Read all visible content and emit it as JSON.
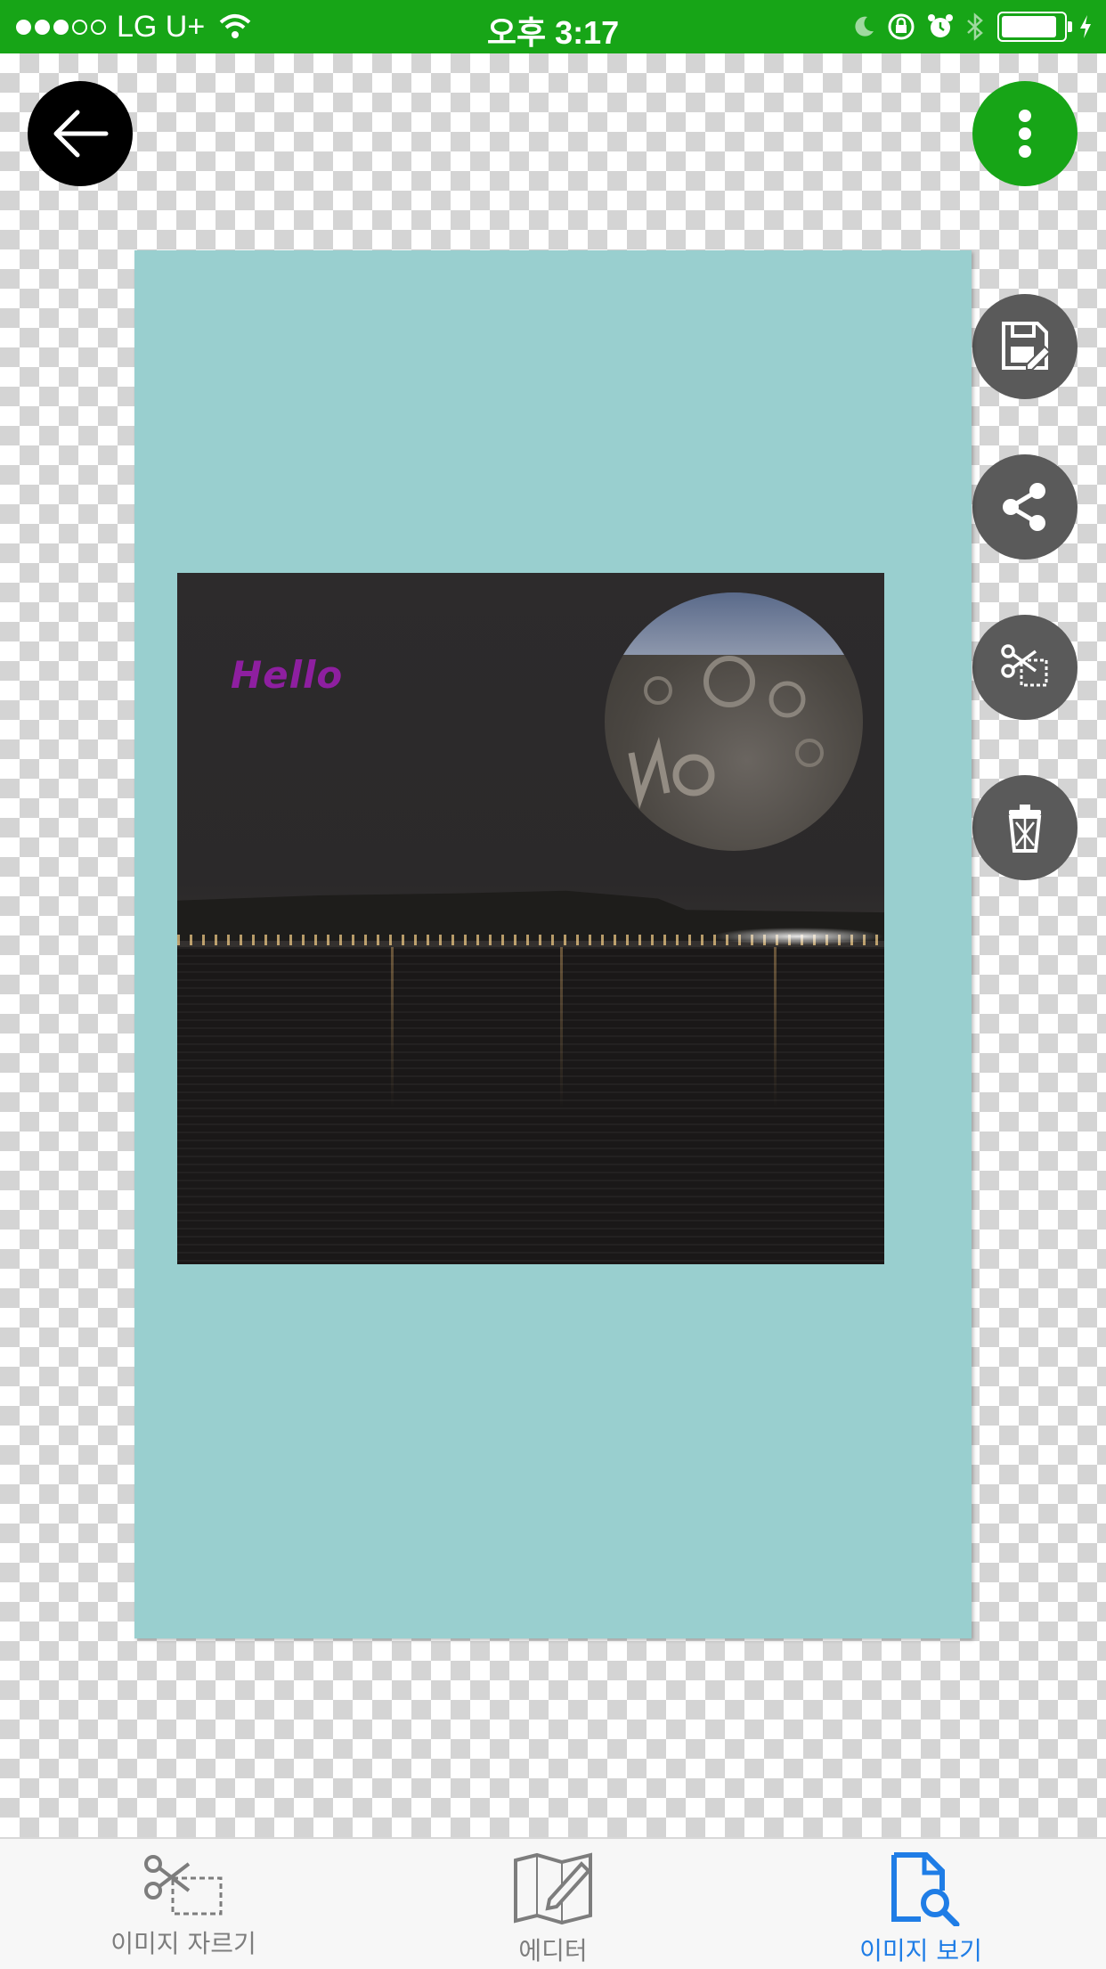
{
  "status_bar": {
    "carrier": "LG U+",
    "time": "오후 3:17",
    "battery_level": 0.9
  },
  "toolbar": {
    "back_icon": "arrow-left-icon",
    "menu_icon": "more-vertical-icon"
  },
  "side_actions": [
    {
      "name": "save",
      "icon": "save-edit-icon"
    },
    {
      "name": "share",
      "icon": "share-icon"
    },
    {
      "name": "crop",
      "icon": "scissors-crop-icon"
    },
    {
      "name": "delete",
      "icon": "trash-icon"
    }
  ],
  "canvas": {
    "background_color": "#99cfcf",
    "overlay_text": "Hello",
    "overlay_text_color": "#8e1fa0"
  },
  "tabs": [
    {
      "label": "이미지 자르기",
      "icon": "crop-scissors-icon",
      "active": false
    },
    {
      "label": "에디터",
      "icon": "map-edit-icon",
      "active": false
    },
    {
      "label": "이미지 보기",
      "icon": "image-search-icon",
      "active": true
    }
  ],
  "colors": {
    "accent_green": "#17a517",
    "active_blue": "#1f7de6",
    "side_button_gray": "#5a5a5a"
  }
}
